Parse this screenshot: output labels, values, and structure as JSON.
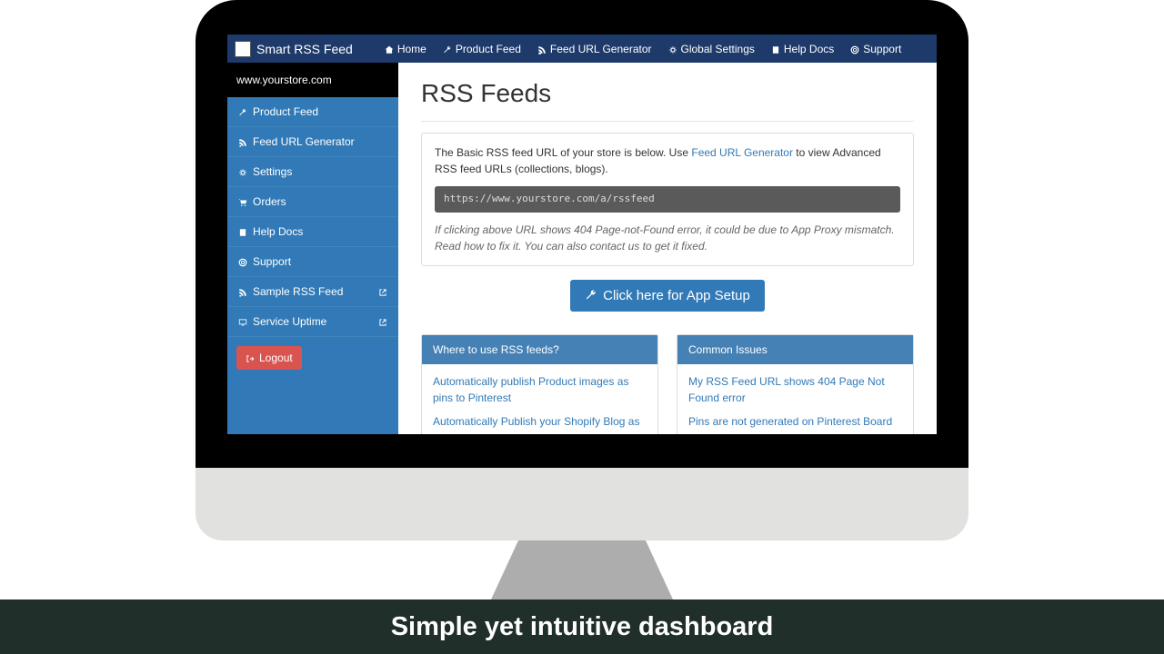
{
  "brand": "Smart RSS Feed",
  "topnav": [
    {
      "icon": "home",
      "label": "Home"
    },
    {
      "icon": "wrench",
      "label": "Product Feed"
    },
    {
      "icon": "rss",
      "label": "Feed URL Generator"
    },
    {
      "icon": "gear",
      "label": "Global Settings"
    },
    {
      "icon": "book",
      "label": "Help Docs"
    },
    {
      "icon": "life-ring",
      "label": "Support"
    }
  ],
  "store_url": "www.yourstore.com",
  "sidebar": [
    {
      "icon": "wrench",
      "label": "Product Feed"
    },
    {
      "icon": "rss",
      "label": "Feed URL Generator"
    },
    {
      "icon": "gear",
      "label": "Settings"
    },
    {
      "icon": "cart",
      "label": "Orders"
    },
    {
      "icon": "book",
      "label": "Help Docs"
    },
    {
      "icon": "life-ring",
      "label": "Support"
    },
    {
      "icon": "rss",
      "label": "Sample RSS Feed",
      "external": true
    },
    {
      "icon": "monitor",
      "label": "Service Uptime",
      "external": true
    }
  ],
  "logout": "Logout",
  "title": "RSS Feeds",
  "intro1": "The Basic RSS feed URL of your store is below. Use ",
  "intro_link": "Feed URL Generator",
  "intro2": " to view Advanced RSS feed URLs (collections, blogs).",
  "url": "https://www.yourstore.com/a/rssfeed",
  "note1": "If clicking above URL shows 404 Page-not-Found error, it could be due to App Proxy mismatch. Read ",
  "note_link1": "how to fix it",
  "note2": ". You can also ",
  "note_link2": "contact us",
  "note3": " to get it fixed.",
  "setup_btn": "Click here for App Setup",
  "card1": {
    "title": "Where to use RSS feeds?",
    "links": [
      "Automatically publish Product images as pins to Pinterest",
      "Automatically Publish your Shopify Blog as"
    ]
  },
  "card2": {
    "title": "Common Issues",
    "links": [
      "My RSS Feed URL shows 404 Page Not Found error",
      "Pins are not generated on Pinterest Board"
    ]
  },
  "caption": "Simple yet intuitive dashboard"
}
